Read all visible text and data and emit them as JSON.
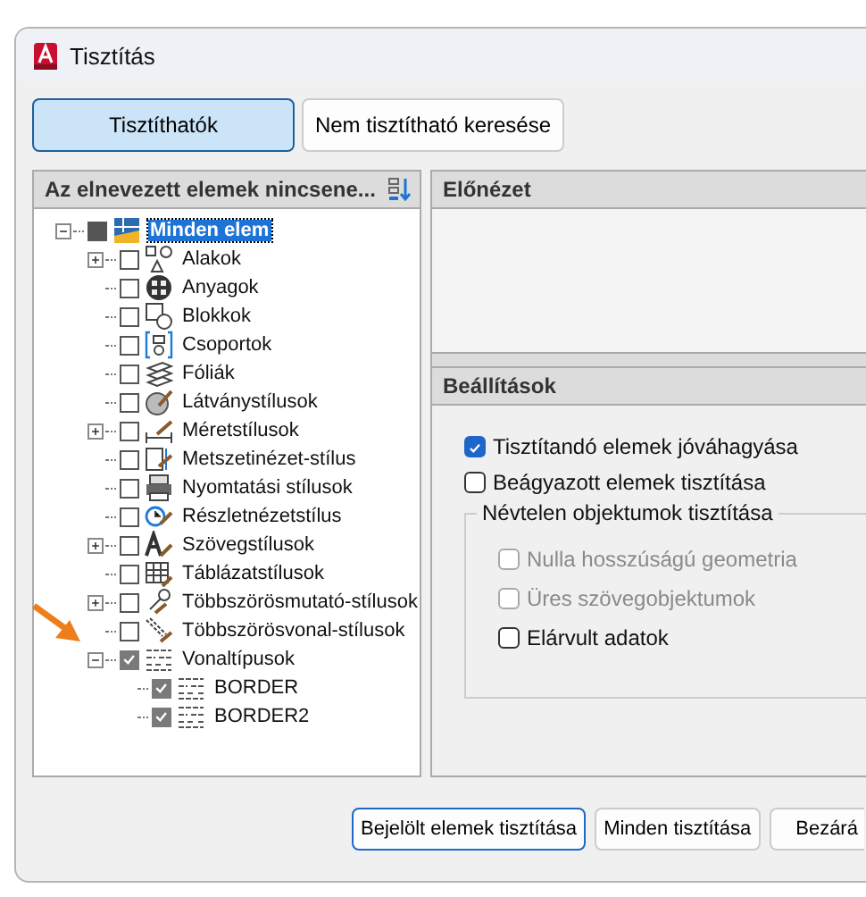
{
  "window": {
    "title": "Tisztítás"
  },
  "view_buttons": [
    {
      "label": "Tisztíthatók",
      "selected": true
    },
    {
      "label": "Nem tisztítható keresése",
      "selected": false
    }
  ],
  "tree_panel": {
    "header": "Az elnevezett elemek nincsene...",
    "items": [
      {
        "label": "Minden elem",
        "kind": "all",
        "checked": false,
        "partial": true,
        "selected": true,
        "expanded": true,
        "children": [
          {
            "label": "Alakok",
            "kind": "shapes",
            "checked": false,
            "selected": false,
            "expanded": false
          },
          {
            "label": "Anyagok",
            "kind": "materials",
            "checked": false,
            "selected": false
          },
          {
            "label": "Blokkok",
            "kind": "blocks",
            "checked": false,
            "selected": false
          },
          {
            "label": "Csoportok",
            "kind": "groups",
            "checked": false,
            "selected": false
          },
          {
            "label": "Fóliák",
            "kind": "layers",
            "checked": false,
            "selected": false
          },
          {
            "label": "Látványstílusok",
            "kind": "visual",
            "checked": false,
            "selected": false
          },
          {
            "label": "Méretstílusok",
            "kind": "dim",
            "checked": false,
            "selected": false,
            "expanded": false
          },
          {
            "label": "Metszetinézet-stílus",
            "kind": "section",
            "checked": false,
            "selected": false
          },
          {
            "label": "Nyomtatási stílusok",
            "kind": "plot",
            "checked": false,
            "selected": false
          },
          {
            "label": "Részletnézetstílus",
            "kind": "detail",
            "checked": false,
            "selected": false
          },
          {
            "label": "Szövegstílusok",
            "kind": "text",
            "checked": false,
            "selected": false,
            "expanded": false
          },
          {
            "label": "Táblázatstílusok",
            "kind": "table",
            "checked": false,
            "selected": false
          },
          {
            "label": "Többszörösmutató-stílusok",
            "kind": "leader",
            "checked": false,
            "selected": false,
            "expanded": false
          },
          {
            "label": "Többszörösvonal-stílusok",
            "kind": "mline",
            "checked": false,
            "selected": false
          },
          {
            "label": "Vonaltípusok",
            "kind": "linetype",
            "checked": true,
            "selected": false,
            "expanded": true,
            "children": [
              {
                "label": "BORDER",
                "kind": "linetype",
                "checked": true,
                "selected": false
              },
              {
                "label": "BORDER2",
                "kind": "linetype",
                "checked": true,
                "selected": false
              }
            ]
          }
        ]
      }
    ]
  },
  "preview": {
    "header": "Előnézet"
  },
  "settings": {
    "header": "Beállítások",
    "options": [
      {
        "label": "Tisztítandó elemek jóváhagyása",
        "checked": true,
        "disabled": false
      },
      {
        "label": "Beágyazott elemek tisztítása",
        "checked": false,
        "disabled": false
      }
    ],
    "group": {
      "title": "Névtelen objektumok tisztítása",
      "options": [
        {
          "label": "Nulla hosszúságú geometria",
          "checked": false,
          "disabled": true
        },
        {
          "label": "Üres szövegobjektumok",
          "checked": false,
          "disabled": true
        },
        {
          "label": "Elárvult adatok",
          "checked": false,
          "disabled": false
        }
      ]
    }
  },
  "buttons": [
    {
      "label": "Bejelölt elemek tisztítása",
      "selected": true
    },
    {
      "label": "Minden tisztítása",
      "selected": false
    },
    {
      "label": "Bezárá",
      "selected": false
    }
  ]
}
